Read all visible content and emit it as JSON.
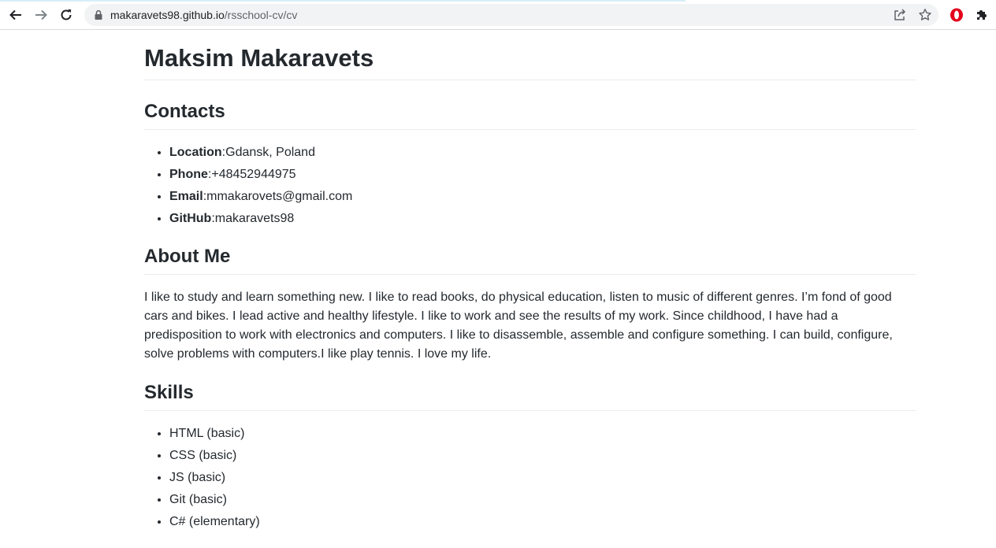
{
  "browser": {
    "url_host": "makaravets98.github.io",
    "url_path": "/rsschool-cv/cv"
  },
  "page": {
    "title": "Maksim Makaravets",
    "contacts": {
      "heading": "Contacts",
      "items": [
        {
          "label": "Location",
          "value": "Gdansk, Poland"
        },
        {
          "label": "Phone",
          "value": "+48452944975"
        },
        {
          "label": "Email",
          "value": "mmakarovets@gmail.com"
        },
        {
          "label": "GitHub",
          "value": "makaravets98"
        }
      ]
    },
    "about": {
      "heading": "About Me",
      "text": "I like to study and learn something new. I like to read books, do physical education, listen to music of different genres. I’m fond of good cars and bikes. I lead active and healthy lifestyle. I like to work and see the results of my work. Since childhood, I have had a predisposition to work with electronics and computers. I like to disassemble, assemble and configure something. I can build, configure, solve problems with computers.I like play tennis. I love my life."
    },
    "skills": {
      "heading": "Skills",
      "items": [
        "HTML (basic)",
        "CSS (basic)",
        "JS (basic)",
        "Git (basic)",
        "C# (elementary)"
      ]
    }
  }
}
